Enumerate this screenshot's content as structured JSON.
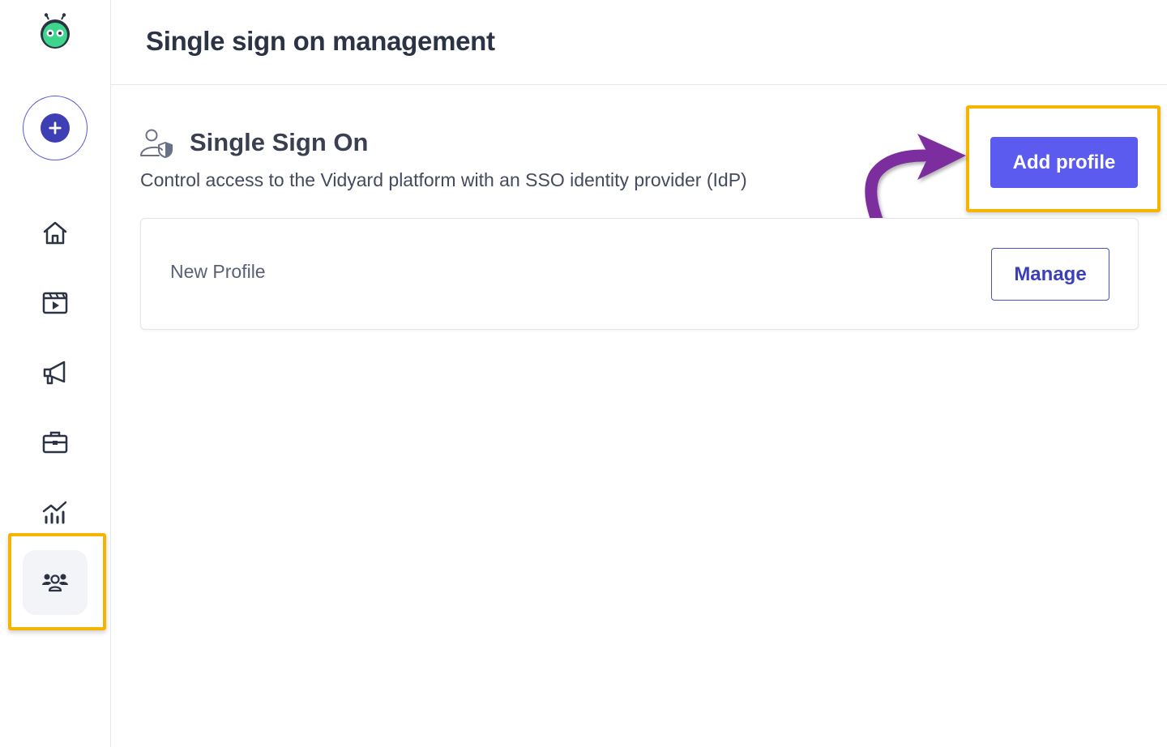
{
  "header": {
    "title": "Single sign on management"
  },
  "sidebar": {
    "logo_icon": "vidyard-robot-logo-icon",
    "create_icon": "plus-icon",
    "items": [
      {
        "icon": "home-icon"
      },
      {
        "icon": "video-library-icon"
      },
      {
        "icon": "megaphone-icon"
      },
      {
        "icon": "briefcase-icon"
      },
      {
        "icon": "analytics-icon"
      },
      {
        "icon": "users-icon",
        "active": true
      }
    ]
  },
  "section": {
    "icon": "user-shield-icon",
    "title": "Single Sign On",
    "description": "Control access to the Vidyard platform with an SSO identity provider (IdP)",
    "add_button_label": "Add profile"
  },
  "profiles": [
    {
      "name": "New Profile",
      "manage_label": "Manage"
    }
  ],
  "colors": {
    "accent": "#5b5bf0",
    "accent_dark": "#3f3fb5",
    "annotation_highlight": "#f5b400",
    "annotation_arrow": "#7b2f9e"
  }
}
